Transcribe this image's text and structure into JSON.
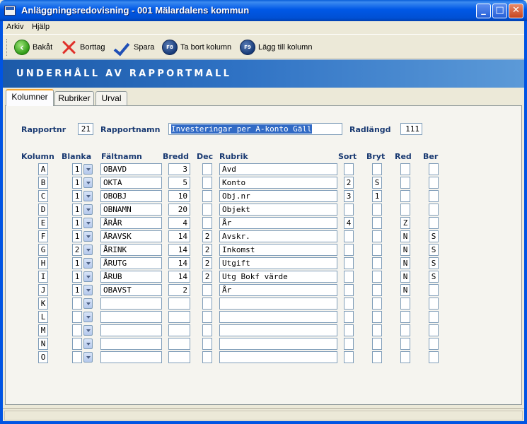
{
  "window": {
    "title": "Anläggningsredovisning  -  001 Mälardalens kommun",
    "minimize": "_",
    "maximize": "□",
    "close": "✕"
  },
  "menu": {
    "items": [
      "Arkiv",
      "Hjälp"
    ]
  },
  "toolbar": {
    "back": "Bakåt",
    "delete": "Borttag",
    "save": "Spara",
    "remove_column": "Ta bort kolumn",
    "add_column": "Lägg till kolumn",
    "f8_key": "F8",
    "f9_key": "F9",
    "back_glyph": "‹"
  },
  "header": {
    "title": "UNDERHÅLL AV RAPPORTMALL"
  },
  "tabs": [
    "Kolumner",
    "Rubriker",
    "Urval"
  ],
  "form": {
    "rapportnr_label": "Rapportnr",
    "rapportnr": "21",
    "rapportnamn_label": "Rapportnamn",
    "rapportnamn": "Investeringar per A-konto Gäll",
    "radlangd_label": "Radlängd",
    "radlangd": "111"
  },
  "columns_header": [
    "Kolumn",
    "Blanka",
    "Fältnamn",
    "Bredd",
    "Dec",
    "Rubrik",
    "Sort",
    "Bryt",
    "Red",
    "Ber"
  ],
  "rows": [
    {
      "kolumn": "A",
      "blanka": "1",
      "faltnamn": "OBAVD",
      "bredd": "3",
      "dec": "",
      "rubrik": "Avd",
      "sort": "",
      "bryt": "",
      "red": "",
      "ber": ""
    },
    {
      "kolumn": "B",
      "blanka": "1",
      "faltnamn": "OKTA",
      "bredd": "5",
      "dec": "",
      "rubrik": "Konto",
      "sort": "2",
      "bryt": "S",
      "red": "",
      "ber": ""
    },
    {
      "kolumn": "C",
      "blanka": "1",
      "faltnamn": "OBOBJ",
      "bredd": "10",
      "dec": "",
      "rubrik": "Obj.nr",
      "sort": "3",
      "bryt": "1",
      "red": "",
      "ber": ""
    },
    {
      "kolumn": "D",
      "blanka": "1",
      "faltnamn": "OBNAMN",
      "bredd": "20",
      "dec": "",
      "rubrik": "Objekt",
      "sort": "",
      "bryt": "",
      "red": "",
      "ber": ""
    },
    {
      "kolumn": "E",
      "blanka": "1",
      "faltnamn": "ÅRÅR",
      "bredd": "4",
      "dec": "",
      "rubrik": "År",
      "sort": "4",
      "bryt": "",
      "red": "Z",
      "ber": ""
    },
    {
      "kolumn": "F",
      "blanka": "1",
      "faltnamn": "ÅRAVSK",
      "bredd": "14",
      "dec": "2",
      "rubrik": "Avskr.",
      "sort": "",
      "bryt": "",
      "red": "N",
      "ber": "S"
    },
    {
      "kolumn": "G",
      "blanka": "2",
      "faltnamn": "ÅRINK",
      "bredd": "14",
      "dec": "2",
      "rubrik": "Inkomst",
      "sort": "",
      "bryt": "",
      "red": "N",
      "ber": "S"
    },
    {
      "kolumn": "H",
      "blanka": "1",
      "faltnamn": "ÅRUTG",
      "bredd": "14",
      "dec": "2",
      "rubrik": "Utgift",
      "sort": "",
      "bryt": "",
      "red": "N",
      "ber": "S"
    },
    {
      "kolumn": "I",
      "blanka": "1",
      "faltnamn": "ÅRUB",
      "bredd": "14",
      "dec": "2",
      "rubrik": "Utg Bokf värde",
      "sort": "",
      "bryt": "",
      "red": "N",
      "ber": "S"
    },
    {
      "kolumn": "J",
      "blanka": "1",
      "faltnamn": "OBAVST",
      "bredd": "2",
      "dec": "",
      "rubrik": "År",
      "sort": "",
      "bryt": "",
      "red": "N",
      "ber": ""
    },
    {
      "kolumn": "K",
      "blanka": "",
      "faltnamn": "",
      "bredd": "",
      "dec": "",
      "rubrik": "",
      "sort": "",
      "bryt": "",
      "red": "",
      "ber": ""
    },
    {
      "kolumn": "L",
      "blanka": "",
      "faltnamn": "",
      "bredd": "",
      "dec": "",
      "rubrik": "",
      "sort": "",
      "bryt": "",
      "red": "",
      "ber": ""
    },
    {
      "kolumn": "M",
      "blanka": "",
      "faltnamn": "",
      "bredd": "",
      "dec": "",
      "rubrik": "",
      "sort": "",
      "bryt": "",
      "red": "",
      "ber": ""
    },
    {
      "kolumn": "N",
      "blanka": "",
      "faltnamn": "",
      "bredd": "",
      "dec": "",
      "rubrik": "",
      "sort": "",
      "bryt": "",
      "red": "",
      "ber": ""
    },
    {
      "kolumn": "O",
      "blanka": "",
      "faltnamn": "",
      "bredd": "",
      "dec": "",
      "rubrik": "",
      "sort": "",
      "bryt": "",
      "red": "",
      "ber": ""
    }
  ]
}
